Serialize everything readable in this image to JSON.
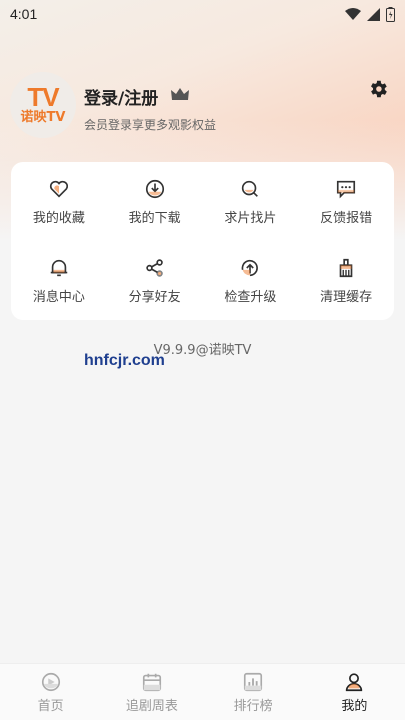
{
  "status_bar": {
    "time": "4:01"
  },
  "profile": {
    "logo_tv": "TV",
    "logo_name": "诺映TV",
    "title": "登录/注册",
    "subtitle": "会员登录享更多观影权益"
  },
  "grid": [
    {
      "label": "我的收藏",
      "icon": "heart-icon"
    },
    {
      "label": "我的下载",
      "icon": "download-icon"
    },
    {
      "label": "求片找片",
      "icon": "search-film-icon"
    },
    {
      "label": "反馈报错",
      "icon": "feedback-icon"
    },
    {
      "label": "消息中心",
      "icon": "bell-icon"
    },
    {
      "label": "分享好友",
      "icon": "share-icon"
    },
    {
      "label": "检查升级",
      "icon": "upgrade-icon"
    },
    {
      "label": "清理缓存",
      "icon": "broom-icon"
    }
  ],
  "version": "V9.9.9@诺映TV",
  "watermark": "hnfcjr.com",
  "nav": [
    {
      "label": "首页",
      "icon": "home-icon",
      "active": false
    },
    {
      "label": "追剧周表",
      "icon": "calendar-icon",
      "active": false
    },
    {
      "label": "排行榜",
      "icon": "ranking-icon",
      "active": false
    },
    {
      "label": "我的",
      "icon": "profile-icon",
      "active": true
    }
  ],
  "colors": {
    "accent": "#ee7a2b",
    "icon_stroke": "#333333",
    "nav_inactive": "#999999"
  }
}
